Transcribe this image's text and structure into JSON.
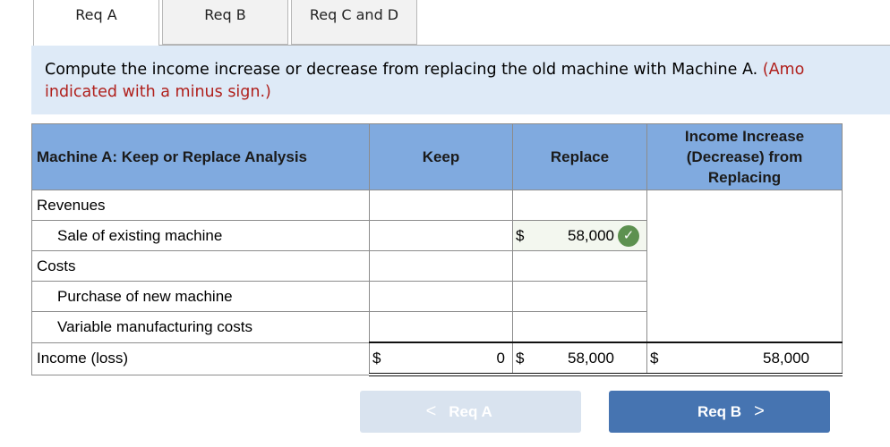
{
  "tabs": [
    {
      "label": "Req A",
      "active": true
    },
    {
      "label": "Req B",
      "active": false
    },
    {
      "label": "Req C and D",
      "active": false
    }
  ],
  "instruction": {
    "text": "Compute the income increase or decrease from replacing the old machine with Machine A.",
    "note": "(Amounts to be deducted should be indicated with a minus sign.)",
    "note_visible_line1": "(Amo",
    "note_visible_line2": "indicated with a minus sign.)"
  },
  "table": {
    "headers": {
      "label": "Machine A: Keep or Replace Analysis",
      "keep": "Keep",
      "replace": "Replace",
      "diff": "Income Increase (Decrease) from Replacing"
    },
    "rows": [
      {
        "label": "Revenues",
        "keep": "",
        "replace": ""
      },
      {
        "label": "Sale of existing machine",
        "keep": "",
        "replace_currency": "$",
        "replace": "58,000",
        "status": "correct"
      },
      {
        "label": "Costs",
        "keep": "",
        "replace": ""
      },
      {
        "label": "Purchase of new machine",
        "keep": "",
        "replace": ""
      },
      {
        "label": "Variable manufacturing costs",
        "keep": "",
        "replace": ""
      }
    ],
    "total": {
      "label": "Income (loss)",
      "currency": "$",
      "keep": "0",
      "replace": "58,000",
      "diff": "58,000"
    }
  },
  "nav": {
    "prev_label": "Req A",
    "next_label": "Req B",
    "prev_icon": "chevron-left-icon",
    "next_icon": "chevron-right-icon"
  },
  "colors": {
    "header_bg": "#80aadf",
    "instruction_bg": "#deeaf7",
    "note_red": "#b0201c",
    "check_green": "#5d9150",
    "next_btn": "#4674b1",
    "prev_btn_disabled": "#d9e3ef"
  }
}
